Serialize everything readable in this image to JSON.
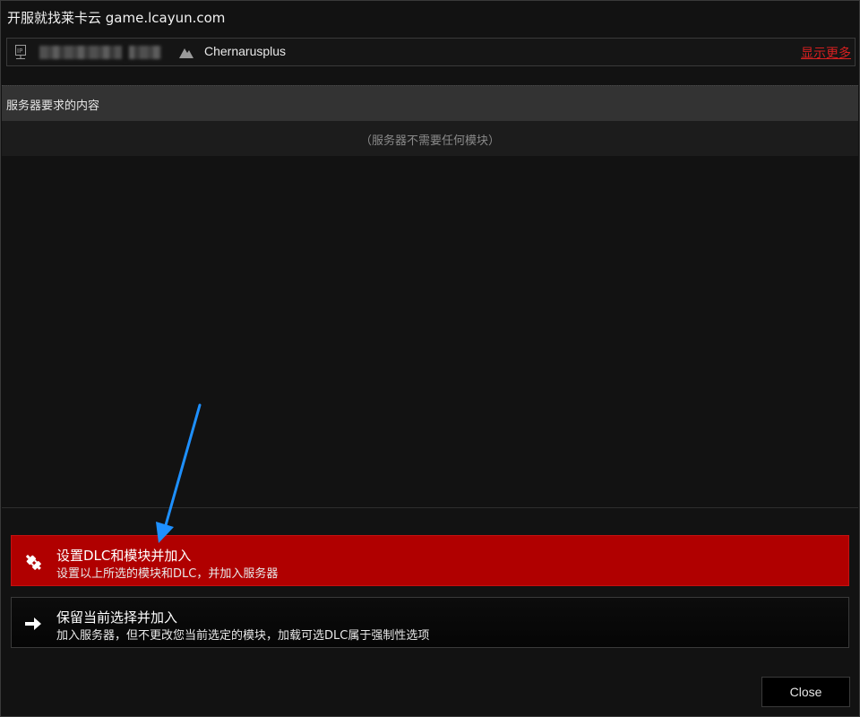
{
  "window": {
    "title": "开服就找莱卡云 game.lcayun.com"
  },
  "server_info": {
    "ip_icon": "ip-address-icon",
    "map_icon": "mountain-map-icon",
    "map_name": "Chernarusplus",
    "show_more_label": "显示更多"
  },
  "requirements": {
    "header": "服务器要求的内容",
    "empty_text": "（服务器不需要任何模块）"
  },
  "actions": {
    "setup_join": {
      "icon": "plug-icon",
      "label": "设置DLC和模块并加入",
      "description": "设置以上所选的模块和DLC，并加入服务器"
    },
    "keep_join": {
      "icon": "arrow-right-icon",
      "label": "保留当前选择并加入",
      "description": "加入服务器，但不更改您当前选定的模块，加载可选DLC属于强制性选项"
    }
  },
  "footer": {
    "close_label": "Close"
  },
  "colors": {
    "accent_red": "#b00000",
    "link_red": "#d42020",
    "annotation_arrow": "#1e90ff"
  }
}
